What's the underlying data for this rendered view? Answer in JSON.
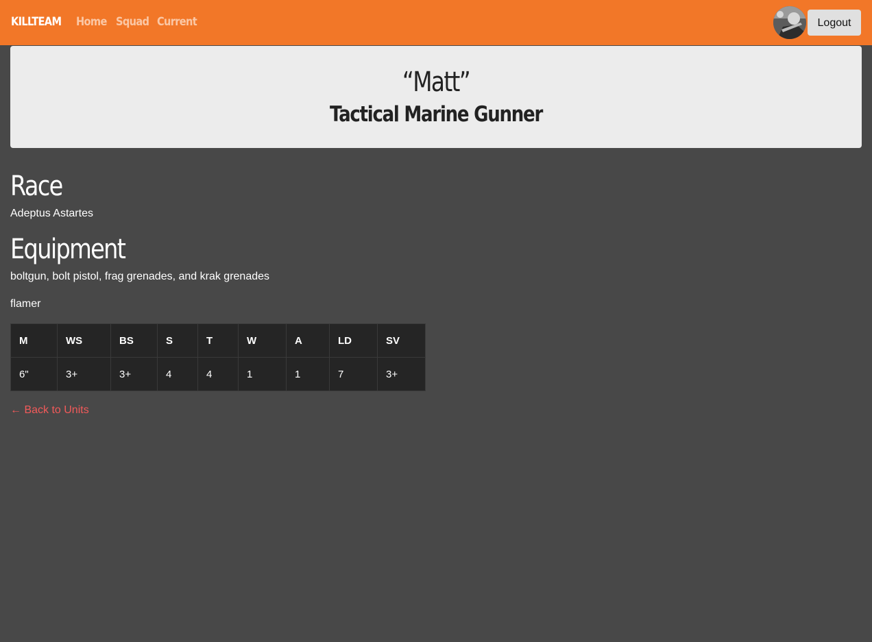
{
  "nav": {
    "brand": "KILLTEAM",
    "links": [
      "Home",
      "Squad",
      "Current"
    ],
    "logout_label": "Logout"
  },
  "unit": {
    "name": "“Matt”",
    "type": "Tactical Marine Gunner"
  },
  "race": {
    "heading": "Race",
    "value": "Adeptus Astartes"
  },
  "equipment": {
    "heading": "Equipment",
    "items": [
      "boltgun, bolt pistol, frag grenades, and krak grenades",
      "flamer"
    ]
  },
  "stats": {
    "headers": [
      "M",
      "WS",
      "BS",
      "S",
      "T",
      "W",
      "A",
      "LD",
      "SV"
    ],
    "values": [
      "6\"",
      "3+",
      "3+",
      "4",
      "4",
      "1",
      "1",
      "7",
      "3+"
    ]
  },
  "back_link": "← Back to Units",
  "colors": {
    "navbar": "#f27728",
    "background": "#484848",
    "jumbotron": "#ececec",
    "table": "#252525",
    "link": "#f25a5a"
  }
}
